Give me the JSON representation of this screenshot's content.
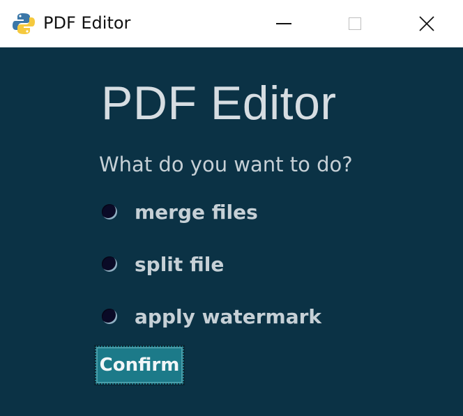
{
  "window": {
    "title": "PDF Editor",
    "icon": "python-logo-icon",
    "controls": [
      "minimize-icon",
      "maximize-icon",
      "close-icon"
    ]
  },
  "main": {
    "heading": "PDF Editor",
    "question": "What do you want to do?",
    "options": [
      {
        "label": "merge files",
        "selected": false
      },
      {
        "label": "split file",
        "selected": false
      },
      {
        "label": "apply watermark",
        "selected": false
      }
    ],
    "confirm_label": "Confirm"
  },
  "colors": {
    "background": "#0b3245",
    "text": "#c6d0d6",
    "heading_text": "#d6dde2",
    "button": "#1c7a89",
    "radio_fill": "#0a0a26"
  }
}
